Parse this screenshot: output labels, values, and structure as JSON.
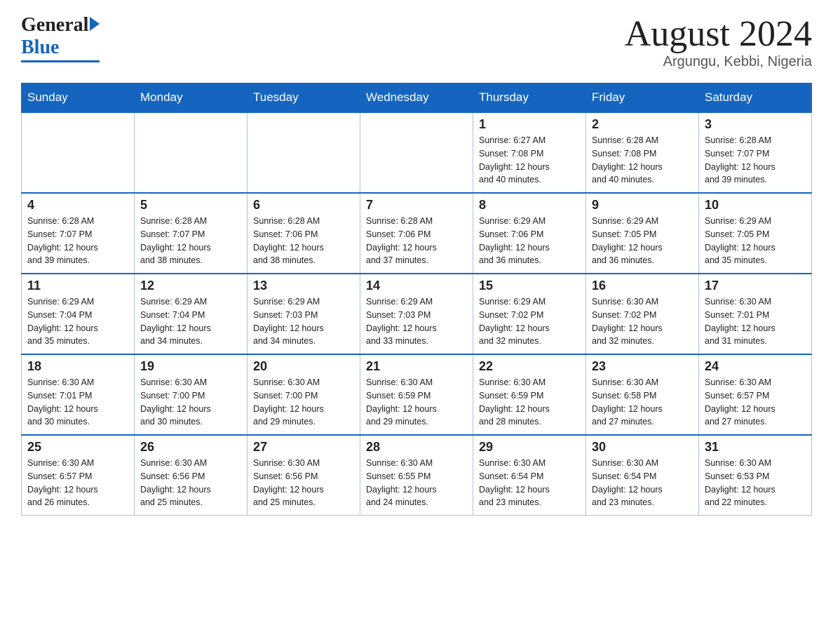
{
  "header": {
    "logo_general": "General",
    "logo_blue": "Blue",
    "title": "August 2024",
    "subtitle": "Argungu, Kebbi, Nigeria"
  },
  "weekdays": [
    "Sunday",
    "Monday",
    "Tuesday",
    "Wednesday",
    "Thursday",
    "Friday",
    "Saturday"
  ],
  "weeks": [
    [
      {
        "day": "",
        "info": ""
      },
      {
        "day": "",
        "info": ""
      },
      {
        "day": "",
        "info": ""
      },
      {
        "day": "",
        "info": ""
      },
      {
        "day": "1",
        "info": "Sunrise: 6:27 AM\nSunset: 7:08 PM\nDaylight: 12 hours\nand 40 minutes."
      },
      {
        "day": "2",
        "info": "Sunrise: 6:28 AM\nSunset: 7:08 PM\nDaylight: 12 hours\nand 40 minutes."
      },
      {
        "day": "3",
        "info": "Sunrise: 6:28 AM\nSunset: 7:07 PM\nDaylight: 12 hours\nand 39 minutes."
      }
    ],
    [
      {
        "day": "4",
        "info": "Sunrise: 6:28 AM\nSunset: 7:07 PM\nDaylight: 12 hours\nand 39 minutes."
      },
      {
        "day": "5",
        "info": "Sunrise: 6:28 AM\nSunset: 7:07 PM\nDaylight: 12 hours\nand 38 minutes."
      },
      {
        "day": "6",
        "info": "Sunrise: 6:28 AM\nSunset: 7:06 PM\nDaylight: 12 hours\nand 38 minutes."
      },
      {
        "day": "7",
        "info": "Sunrise: 6:28 AM\nSunset: 7:06 PM\nDaylight: 12 hours\nand 37 minutes."
      },
      {
        "day": "8",
        "info": "Sunrise: 6:29 AM\nSunset: 7:06 PM\nDaylight: 12 hours\nand 36 minutes."
      },
      {
        "day": "9",
        "info": "Sunrise: 6:29 AM\nSunset: 7:05 PM\nDaylight: 12 hours\nand 36 minutes."
      },
      {
        "day": "10",
        "info": "Sunrise: 6:29 AM\nSunset: 7:05 PM\nDaylight: 12 hours\nand 35 minutes."
      }
    ],
    [
      {
        "day": "11",
        "info": "Sunrise: 6:29 AM\nSunset: 7:04 PM\nDaylight: 12 hours\nand 35 minutes."
      },
      {
        "day": "12",
        "info": "Sunrise: 6:29 AM\nSunset: 7:04 PM\nDaylight: 12 hours\nand 34 minutes."
      },
      {
        "day": "13",
        "info": "Sunrise: 6:29 AM\nSunset: 7:03 PM\nDaylight: 12 hours\nand 34 minutes."
      },
      {
        "day": "14",
        "info": "Sunrise: 6:29 AM\nSunset: 7:03 PM\nDaylight: 12 hours\nand 33 minutes."
      },
      {
        "day": "15",
        "info": "Sunrise: 6:29 AM\nSunset: 7:02 PM\nDaylight: 12 hours\nand 32 minutes."
      },
      {
        "day": "16",
        "info": "Sunrise: 6:30 AM\nSunset: 7:02 PM\nDaylight: 12 hours\nand 32 minutes."
      },
      {
        "day": "17",
        "info": "Sunrise: 6:30 AM\nSunset: 7:01 PM\nDaylight: 12 hours\nand 31 minutes."
      }
    ],
    [
      {
        "day": "18",
        "info": "Sunrise: 6:30 AM\nSunset: 7:01 PM\nDaylight: 12 hours\nand 30 minutes."
      },
      {
        "day": "19",
        "info": "Sunrise: 6:30 AM\nSunset: 7:00 PM\nDaylight: 12 hours\nand 30 minutes."
      },
      {
        "day": "20",
        "info": "Sunrise: 6:30 AM\nSunset: 7:00 PM\nDaylight: 12 hours\nand 29 minutes."
      },
      {
        "day": "21",
        "info": "Sunrise: 6:30 AM\nSunset: 6:59 PM\nDaylight: 12 hours\nand 29 minutes."
      },
      {
        "day": "22",
        "info": "Sunrise: 6:30 AM\nSunset: 6:59 PM\nDaylight: 12 hours\nand 28 minutes."
      },
      {
        "day": "23",
        "info": "Sunrise: 6:30 AM\nSunset: 6:58 PM\nDaylight: 12 hours\nand 27 minutes."
      },
      {
        "day": "24",
        "info": "Sunrise: 6:30 AM\nSunset: 6:57 PM\nDaylight: 12 hours\nand 27 minutes."
      }
    ],
    [
      {
        "day": "25",
        "info": "Sunrise: 6:30 AM\nSunset: 6:57 PM\nDaylight: 12 hours\nand 26 minutes."
      },
      {
        "day": "26",
        "info": "Sunrise: 6:30 AM\nSunset: 6:56 PM\nDaylight: 12 hours\nand 25 minutes."
      },
      {
        "day": "27",
        "info": "Sunrise: 6:30 AM\nSunset: 6:56 PM\nDaylight: 12 hours\nand 25 minutes."
      },
      {
        "day": "28",
        "info": "Sunrise: 6:30 AM\nSunset: 6:55 PM\nDaylight: 12 hours\nand 24 minutes."
      },
      {
        "day": "29",
        "info": "Sunrise: 6:30 AM\nSunset: 6:54 PM\nDaylight: 12 hours\nand 23 minutes."
      },
      {
        "day": "30",
        "info": "Sunrise: 6:30 AM\nSunset: 6:54 PM\nDaylight: 12 hours\nand 23 minutes."
      },
      {
        "day": "31",
        "info": "Sunrise: 6:30 AM\nSunset: 6:53 PM\nDaylight: 12 hours\nand 22 minutes."
      }
    ]
  ]
}
